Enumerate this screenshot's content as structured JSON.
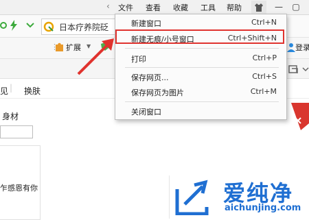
{
  "menubar": {
    "arrow": "‹",
    "items": [
      "文件",
      "查看",
      "收藏",
      "工具",
      "帮助"
    ],
    "controls": [
      "—",
      "▢",
      "✕"
    ]
  },
  "addressbar": {
    "url_text": "日本疗养院砭"
  },
  "toolbar": {
    "extensions_label": "扩展",
    "login_label": "登录"
  },
  "row3": {
    "items": [
      "见",
      "换肤"
    ]
  },
  "content": {
    "body_label": "身材",
    "snippet": "乍感恩有你"
  },
  "dropdown": {
    "items": [
      {
        "label": "新建窗口",
        "shortcut": "Ctrl+N"
      },
      {
        "label": "新建无痕/小号窗口",
        "shortcut": "Ctrl+Shift+N"
      },
      {
        "label": "打印",
        "shortcut": "Ctrl+P"
      },
      {
        "label": "保存网页...",
        "shortcut": "Ctrl+S"
      },
      {
        "label": "保存网页为图片",
        "shortcut": "Ctrl+M"
      },
      {
        "label": "关闭窗口",
        "shortcut": ""
      }
    ]
  },
  "watermark": {
    "brand": "爱纯净",
    "url": "aichunjing.com"
  },
  "colors": {
    "highlight": "#e0332e",
    "watermark": "#1f6fd2",
    "menubar_bg": "#f1f1f1"
  }
}
